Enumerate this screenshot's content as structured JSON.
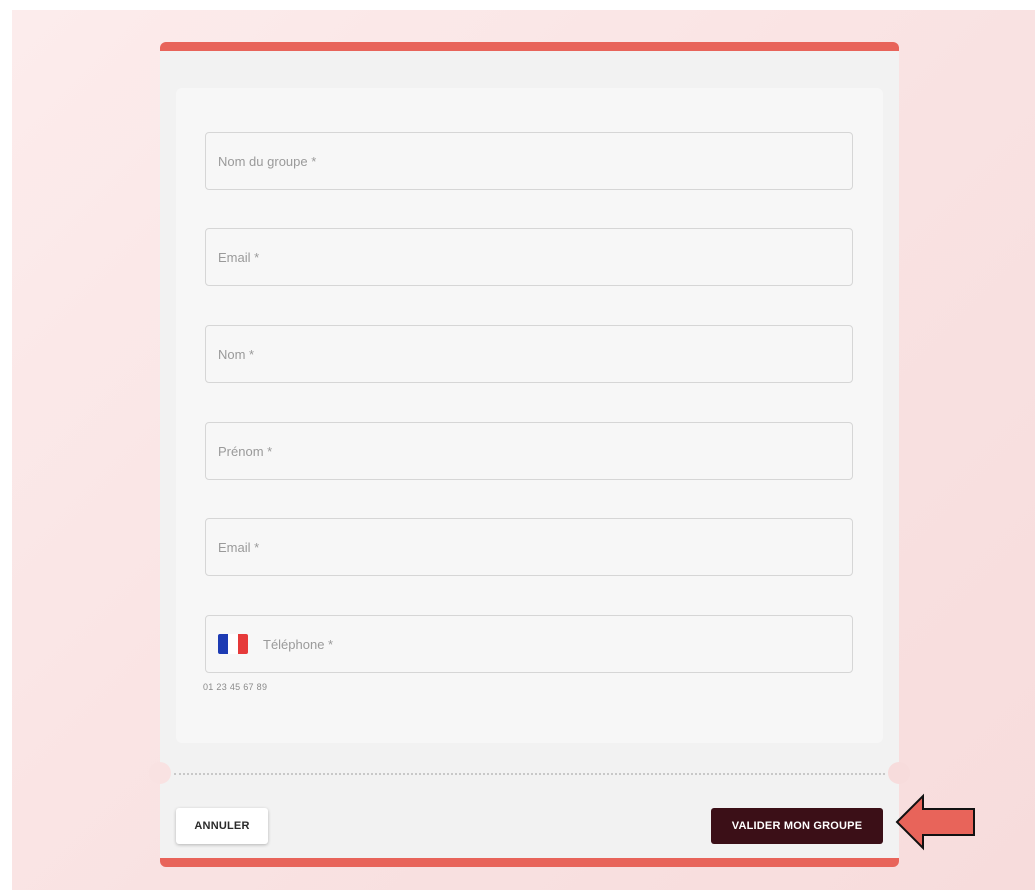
{
  "colors": {
    "accent": "#e8645a",
    "primary_button": "#3b0f17",
    "background": "#f9e2e2"
  },
  "form": {
    "fields": [
      {
        "placeholder": "Nom du groupe *",
        "value": ""
      },
      {
        "placeholder": "Email *",
        "value": ""
      },
      {
        "placeholder": "Nom *",
        "value": ""
      },
      {
        "placeholder": "Prénom *",
        "value": ""
      },
      {
        "placeholder": "Email *",
        "value": ""
      }
    ],
    "phone": {
      "placeholder": "Téléphone *",
      "flag": "france-flag-icon",
      "hint": "01 23 45 67 89"
    }
  },
  "actions": {
    "cancel_label": "ANNULER",
    "submit_label": "VALIDER MON GROUPE"
  },
  "annotation": {
    "icon": "arrow-left-icon",
    "color": "#e8645a"
  }
}
